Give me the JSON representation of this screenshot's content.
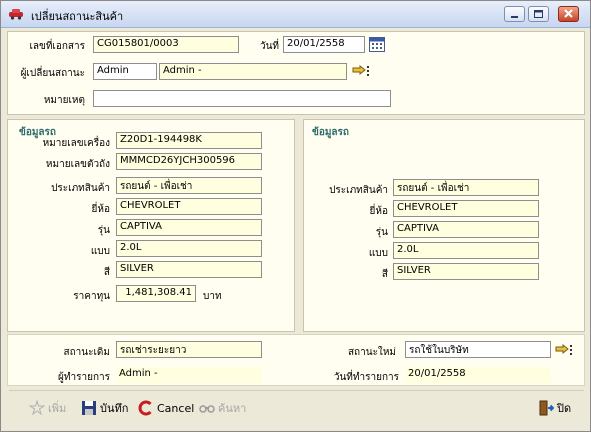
{
  "window": {
    "title": "เปลี่ยนสถานะสินค้า"
  },
  "header": {
    "doc_no_label": "เลขที่เอกสาร",
    "doc_no": "CG015801/0003",
    "date_label": "วันที่",
    "date": "20/01/2558",
    "changer_label": "ผู้เปลี่ยนสถานะ",
    "changer_code": "Admin",
    "changer_name": "Admin -",
    "remark_label": "หมายเหตุ",
    "remark": ""
  },
  "left": {
    "section_title": "ข้อมูลรถ",
    "engine_label": "หมายเลขเครื่อง",
    "engine": "Z20D1-194498K",
    "chassis_label": "หมายเลขตัวถัง",
    "chassis": "MMMCD26YJCH300596",
    "type_label": "ประเภทสินค้า",
    "type": "รถยนต์ - เพื่อเช่า",
    "brand_label": "ยี่ห้อ",
    "brand": "CHEVROLET",
    "model_label": "รุ่น",
    "model": "CAPTIVA",
    "variant_label": "แบบ",
    "variant": "2.0L",
    "color_label": "สี",
    "color": "SILVER",
    "cost_label": "ราคาทุน",
    "cost": "1,481,308.41",
    "cost_unit": "บาท"
  },
  "right": {
    "section_title": "ข้อมูลรถ",
    "type_label": "ประเภทสินค้า",
    "type": "รถยนต์ - เพื่อเช่า",
    "brand_label": "ยี่ห้อ",
    "brand": "CHEVROLET",
    "model_label": "รุ่น",
    "model": "CAPTIVA",
    "variant_label": "แบบ",
    "variant": "2.0L",
    "color_label": "สี",
    "color": "SILVER"
  },
  "status": {
    "old_label": "สถานะเดิม",
    "old": "รถเช่าระยะยาว",
    "new_label": "สถานะใหม่",
    "new": "รถใช้ในบริษัท",
    "operator_label": "ผู้ทำรายการ",
    "operator": "Admin -",
    "op_date_label": "วันที่ทำรายการ",
    "op_date": "20/01/2558"
  },
  "toolbar": {
    "add": "เพิ่ม",
    "save": "บันทึก",
    "cancel": "Cancel",
    "search": "ค้นหา",
    "close": "ปิด"
  },
  "colors": {
    "field_bg": "#ffffe0",
    "panel_bg": "#fffef0",
    "section_title": "#2d6b6b",
    "window_bg": "#ece9d8"
  },
  "icons": [
    "car-icon",
    "minimize-icon",
    "maximize-icon",
    "close-icon",
    "calendar-icon",
    "lookup-icon",
    "add-icon",
    "save-icon",
    "cancel-icon",
    "search-icon",
    "exit-icon"
  ]
}
